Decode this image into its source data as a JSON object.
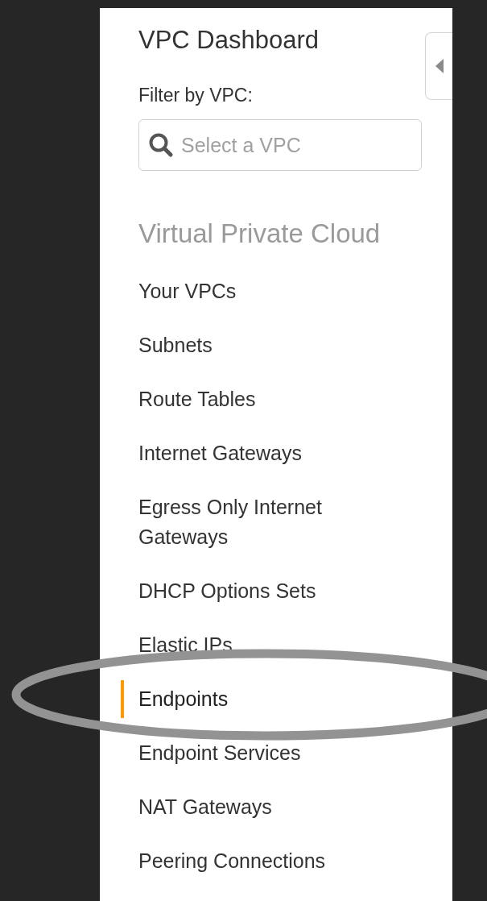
{
  "sidebar": {
    "title": "VPC Dashboard",
    "filter_label": "Filter by VPC:",
    "filter": {
      "placeholder": "Select a VPC"
    },
    "section": "Virtual Private Cloud",
    "items": [
      {
        "label": "Your VPCs",
        "selected": false
      },
      {
        "label": "Subnets",
        "selected": false
      },
      {
        "label": "Route Tables",
        "selected": false
      },
      {
        "label": "Internet Gateways",
        "selected": false
      },
      {
        "label": "Egress Only Internet Gateways",
        "selected": false
      },
      {
        "label": "DHCP Options Sets",
        "selected": false
      },
      {
        "label": "Elastic IPs",
        "selected": false
      },
      {
        "label": "Endpoints",
        "selected": true
      },
      {
        "label": "Endpoint Services",
        "selected": false
      },
      {
        "label": "NAT Gateways",
        "selected": false
      },
      {
        "label": "Peering Connections",
        "selected": false
      }
    ]
  }
}
